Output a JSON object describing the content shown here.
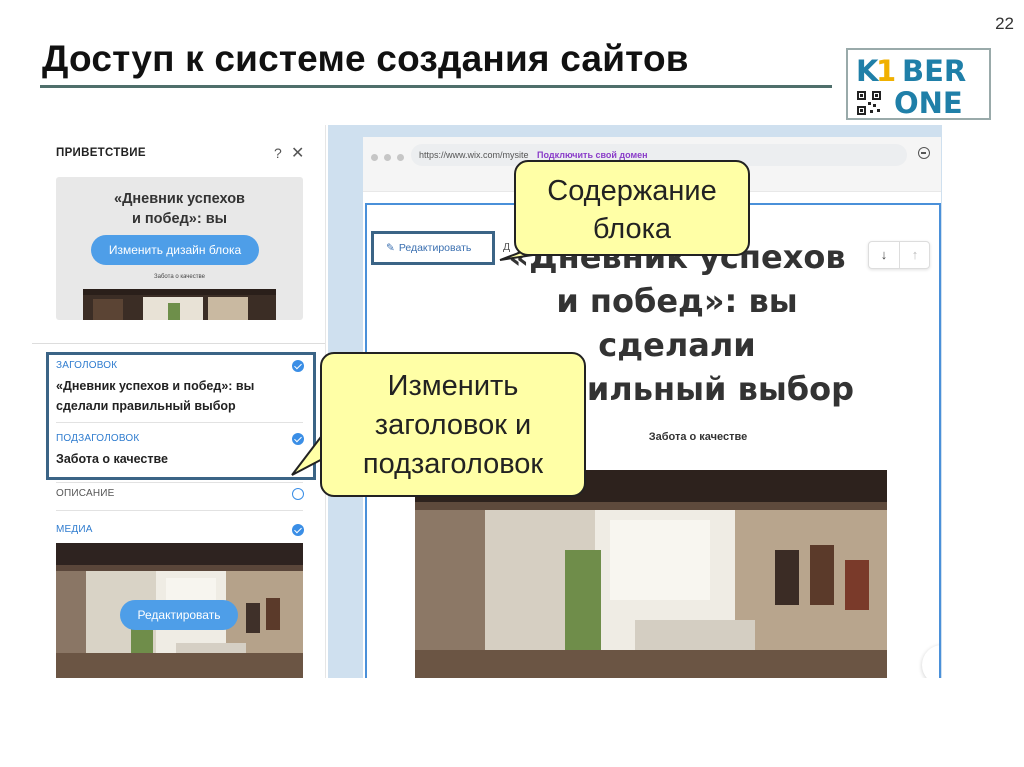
{
  "slide": {
    "title": "Доступ к системе создания сайтов",
    "page_number": "22",
    "logo": {
      "top": "K1BER",
      "bottom": "ONE"
    }
  },
  "panel": {
    "title": "ПРИВЕТСТВИЕ",
    "help": "?",
    "close": "✕",
    "preview": {
      "heading_line1": "«Дневник успехов",
      "heading_line2": "и побед»: вы",
      "button": "Изменить дизайн блока",
      "subtitle": "Забота о качестве"
    },
    "fields": [
      {
        "label": "ЗАГОЛОВОК",
        "value": "«Дневник успехов и побед»: вы сделали правильный выбор",
        "checked": true
      },
      {
        "label": "ПОДЗАГОЛОВОК",
        "value": "Забота о качестве",
        "checked": true
      },
      {
        "label": "ОПИСАНИЕ",
        "value": "",
        "checked": false
      },
      {
        "label": "МЕДИА",
        "value": "",
        "checked": true
      }
    ],
    "media_button": "Редактировать"
  },
  "browser": {
    "url": "https://www.wix.com/mysite",
    "url_link": "Подключить свой домен"
  },
  "site": {
    "edit_button": "Редактировать",
    "edit_trail": "Д",
    "heading_line1": "«Дневник успехов",
    "heading_line2": "и побед»: вы",
    "heading_line3": "сделали",
    "heading_line4": "правильный выбор",
    "subtitle": "Забота о качестве",
    "arrow_down": "↓",
    "arrow_up": "↑"
  },
  "callouts": {
    "content_block": "Содержание блока",
    "content_block_line1": "Содержание",
    "content_block_line2": "блока",
    "change_heading_line1": "Изменить",
    "change_heading_line2": "заголовок и",
    "change_heading_line3": "подзаголовок"
  },
  "colors": {
    "accent": "#3a8ee6",
    "highlight_border": "#3b6486",
    "callout_fill": "#ffffa6",
    "title_rule": "#4f6f6b"
  }
}
